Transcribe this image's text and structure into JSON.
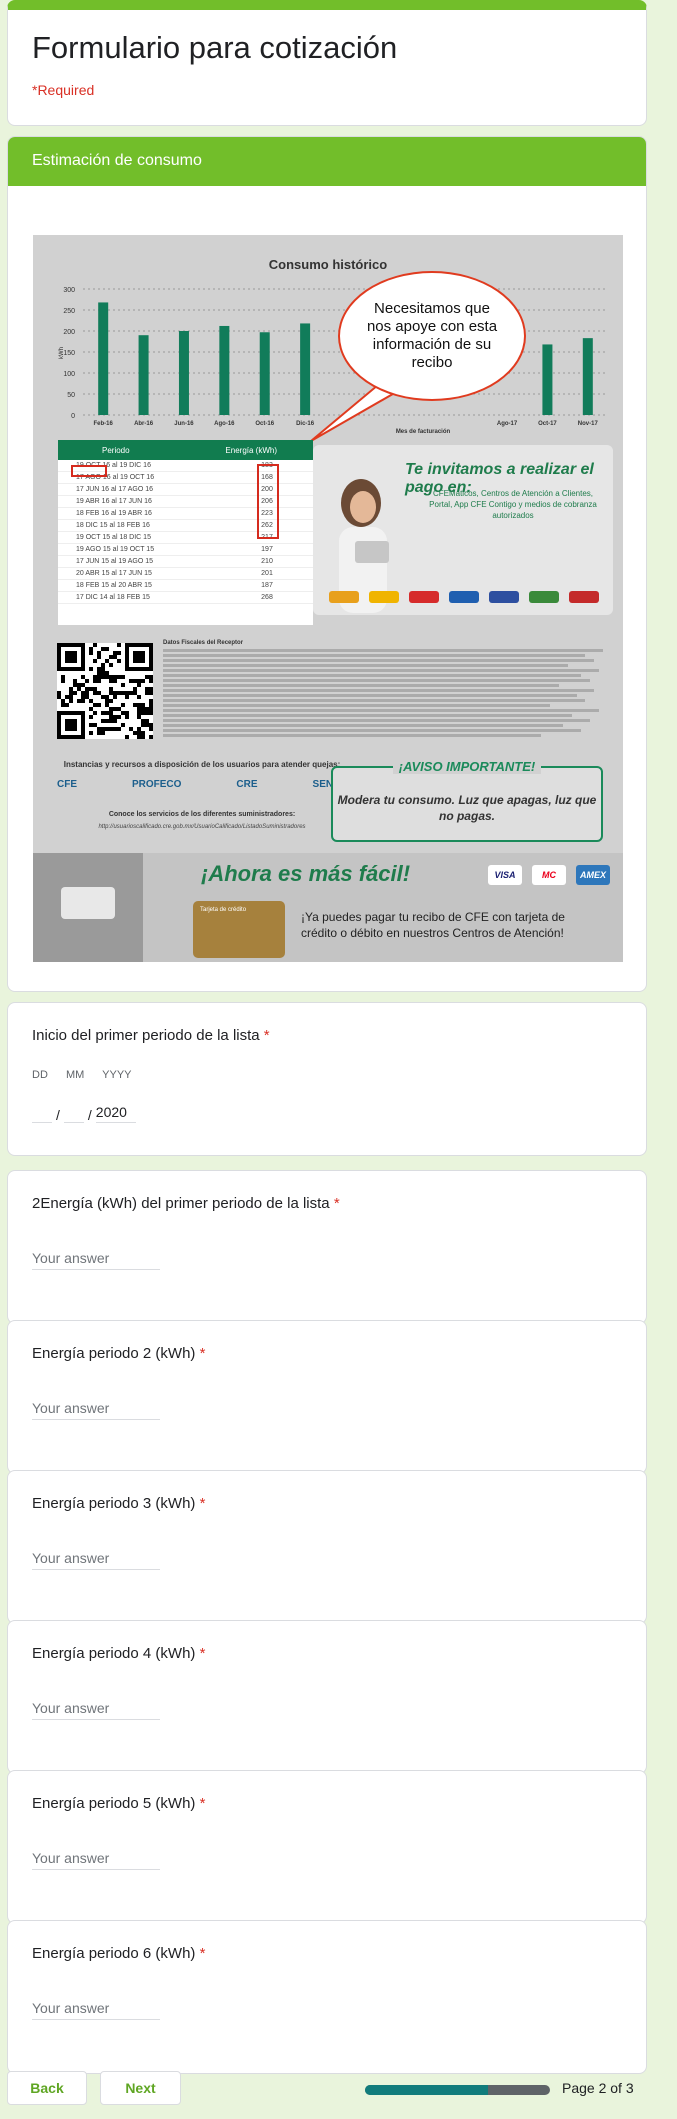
{
  "form": {
    "title": "Formulario para cotización",
    "required_note": "*Required",
    "accent_color": "#72be2a"
  },
  "section": {
    "title": "Estimación de consumo"
  },
  "receipt": {
    "chart": {
      "title": "Consumo histórico",
      "ylabel": "kWh",
      "xlabel": "Mes de facturación",
      "yticks": [
        "300",
        "250",
        "200",
        "150",
        "100",
        "50",
        "0"
      ],
      "xticks": [
        "Feb-16",
        "Abr-16",
        "Jun-16",
        "Ago-16",
        "Oct-16",
        "Dic-16",
        "",
        "",
        "",
        "",
        "Ago-17",
        "Oct-17",
        "Nov-17"
      ],
      "bar_values": [
        268,
        190,
        200,
        212,
        197,
        218,
        0,
        0,
        0,
        0,
        0,
        168,
        183
      ]
    },
    "bubble_text": "Necesitamos que nos apoye con esta información de su recibo",
    "periods_table": {
      "col_period": "Periodo",
      "col_energy": "Energía (kWh)",
      "rows": [
        {
          "period": "19 OCT 16 al 19 DIC 16",
          "kwh": "183"
        },
        {
          "period": "17 AGO 16 al 19 OCT 16",
          "kwh": "168"
        },
        {
          "period": "17 JUN 16 al 17 AGO 16",
          "kwh": "200"
        },
        {
          "period": "19 ABR 16 al 17 JUN 16",
          "kwh": "206"
        },
        {
          "period": "18 FEB 16 al 19 ABR 16",
          "kwh": "223"
        },
        {
          "period": "18 DIC 15 al 18 FEB 16",
          "kwh": "262"
        },
        {
          "period": "19 OCT 15 al 18 DIC 15",
          "kwh": "217"
        },
        {
          "period": "19 AGO 15 al 19 OCT 15",
          "kwh": "197"
        },
        {
          "period": "17 JUN 15 al 19 AGO 15",
          "kwh": "210"
        },
        {
          "period": "20 ABR 15 al 17 JUN 15",
          "kwh": "201"
        },
        {
          "period": "18 FEB 15 al 20 ABR 15",
          "kwh": "187"
        },
        {
          "period": "17 DIC 14 al 18 FEB 15",
          "kwh": "268"
        }
      ]
    },
    "pay_title": "Te invitamos a realizar el pago en:",
    "pay_subtitle": "CFEMáticos, Centros de Atención a Clientes, Portal, App CFE Contigo y medios de cobranza autorizados",
    "fiscal_heading": "Datos Fiscales del Receptor",
    "institutions_title": "Instancias y recursos a disposición de los usuarios para atender quejas:",
    "institution_logos": [
      "CFE",
      "PROFECO",
      "CRE",
      "SENER"
    ],
    "suppliers_text": "Conoce los servicios de los diferentes suministradores:",
    "suppliers_url": "http://usuarioscalificado.cre.gob.mx/UsuarioCalificado/ListadoSuministradores",
    "aviso_title": "¡AVISO IMPORTANTE!",
    "aviso_text": "Modera tu consumo. Luz que apagas, luz que no pagas.",
    "easier_title": "¡Ahora es más fácil!",
    "card_brands": [
      "VISA",
      "MC",
      "AMEX"
    ],
    "card_label": "Tarjeta de crédito",
    "pay_card_text": "¡Ya puedes pagar tu recibo de CFE con tarjeta de crédito o débito en nuestros Centros de Atención!"
  },
  "questions": [
    {
      "title": "Inicio del primer periodo de la lista",
      "type": "date",
      "date_labels": [
        "DD",
        "MM",
        "YYYY"
      ],
      "year_value": "2020"
    },
    {
      "title": "2Energía (kWh) del primer periodo de la lista",
      "placeholder": "Your answer"
    },
    {
      "title": "Energía periodo 2 (kWh)",
      "placeholder": "Your answer"
    },
    {
      "title": "Energía periodo 3 (kWh)",
      "placeholder": "Your answer"
    },
    {
      "title": "Energía periodo 4 (kWh)",
      "placeholder": "Your answer"
    },
    {
      "title": "Energía periodo 5 (kWh)",
      "placeholder": "Your answer"
    },
    {
      "title": "Energía periodo 6 (kWh)",
      "placeholder": "Your answer"
    }
  ],
  "required_star": "*",
  "footer": {
    "back_label": "Back",
    "next_label": "Next",
    "page_label": "Page 2 of 3",
    "progress_fraction": 0.667
  }
}
